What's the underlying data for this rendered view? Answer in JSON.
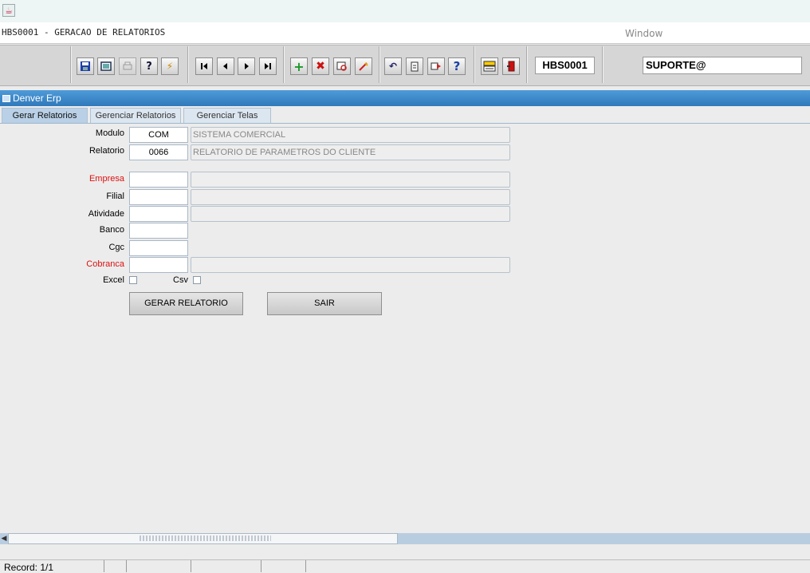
{
  "window": {
    "form_title": "HBS0001 - GERACAO DE RELATORIOS",
    "menu_window": "Window"
  },
  "toolbar": {
    "form_code": "HBS0001",
    "user": "SUPORTE@",
    "icons": [
      "save-icon",
      "screen-icon",
      "print-icon",
      "query-help-icon",
      "execute-icon",
      "first-record-icon",
      "prev-record-icon",
      "next-record-icon",
      "last-record-icon",
      "insert-icon",
      "delete-icon",
      "search-icon",
      "edit-icon",
      "undo-icon",
      "clipboard-icon",
      "export-icon",
      "help-icon",
      "menu-icon",
      "exit-icon"
    ]
  },
  "app": {
    "title": "Denver Erp"
  },
  "tabs": [
    {
      "label": "Gerar Relatorios"
    },
    {
      "label": "Gerenciar Relatorios"
    },
    {
      "label": "Gerenciar Telas"
    }
  ],
  "form": {
    "modulo": {
      "label": "Modulo",
      "code": "COM",
      "desc": "SISTEMA COMERCIAL"
    },
    "relatorio": {
      "label": "Relatorio",
      "code": "0066",
      "desc": "RELATORIO DE PARAMETROS DO CLIENTE"
    },
    "empresa": {
      "label": "Empresa",
      "code": "",
      "desc": ""
    },
    "filial": {
      "label": "Filial",
      "code": "",
      "desc": ""
    },
    "atividade": {
      "label": "Atividade",
      "code": "",
      "desc": ""
    },
    "banco": {
      "label": "Banco",
      "code": ""
    },
    "cgc": {
      "label": "Cgc",
      "code": ""
    },
    "cobranca": {
      "label": "Cobranca",
      "code": "",
      "desc": ""
    },
    "excel": {
      "label": "Excel"
    },
    "csv": {
      "label": "Csv"
    },
    "btn_gerar": "GERAR RELATORIO",
    "btn_sair": "SAIR"
  },
  "colors": {
    "required_label": "#d11111",
    "accent": "#2f79bb"
  },
  "status": {
    "record": "Record: 1/1"
  }
}
